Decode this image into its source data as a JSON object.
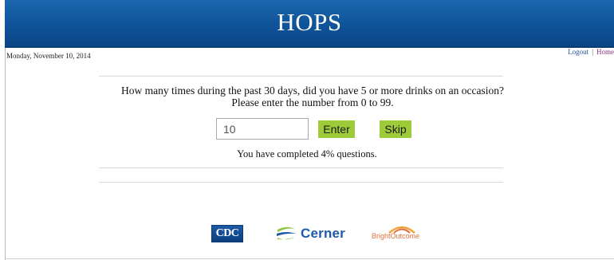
{
  "header": {
    "title": "HOPS"
  },
  "date": "Monday, November 10, 2014",
  "top_links": {
    "logout": "Logout",
    "separator": "|",
    "home": "Home"
  },
  "question": {
    "text": "How many times during the past 30 days, did you have 5 or more drinks on an occasion? Please enter the number from 0 to 99.",
    "answer_value": "10"
  },
  "buttons": {
    "enter": "Enter",
    "skip": "Skip"
  },
  "progress": {
    "text": "You have completed 4% questions.",
    "percent": 4
  },
  "footer_logos": {
    "cdc": "CDC",
    "cerner": "Cerner",
    "brightoutcome": "BrightOutcome"
  },
  "colors": {
    "header_blue": "#0f5399",
    "button_green": "#9ecb3a",
    "link_blue": "#1f4f9a",
    "home_link": "#8a2c78",
    "cerner_blue": "#1e58a8",
    "cerner_green": "#8dc63f",
    "brightoutcome_orange": "#e0703a"
  }
}
